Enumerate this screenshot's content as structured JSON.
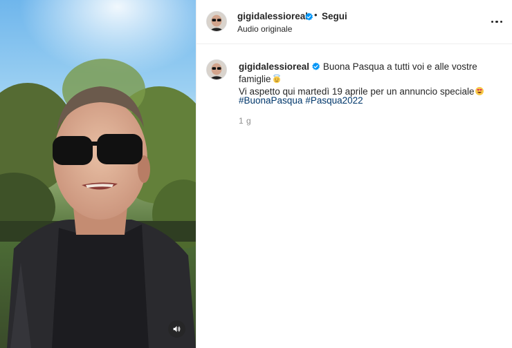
{
  "post": {
    "username": "gigidalessioreal",
    "follow_label": "Segui",
    "separator": "•",
    "audio_label": "Audio originale",
    "caption_line1": "Buona Pasqua a tutti voi e alle vostre famiglie",
    "caption_line2": "Vi aspetto qui martedì 19 aprile per un annuncio speciale",
    "hashtags": [
      "#BuonaPasqua",
      "#Pasqua2022"
    ],
    "time_ago": "1 g"
  },
  "icons": {
    "verified": "verified-badge-icon",
    "more": "more-options-icon",
    "mute": "speaker-icon",
    "emoji1": "angel-face-emoji",
    "emoji2": "heart-eyes-emoji"
  },
  "colors": {
    "verified_blue": "#0095f6",
    "hashtag": "#00376b",
    "muted_text": "#8e8e8e",
    "divider": "#efefef"
  }
}
